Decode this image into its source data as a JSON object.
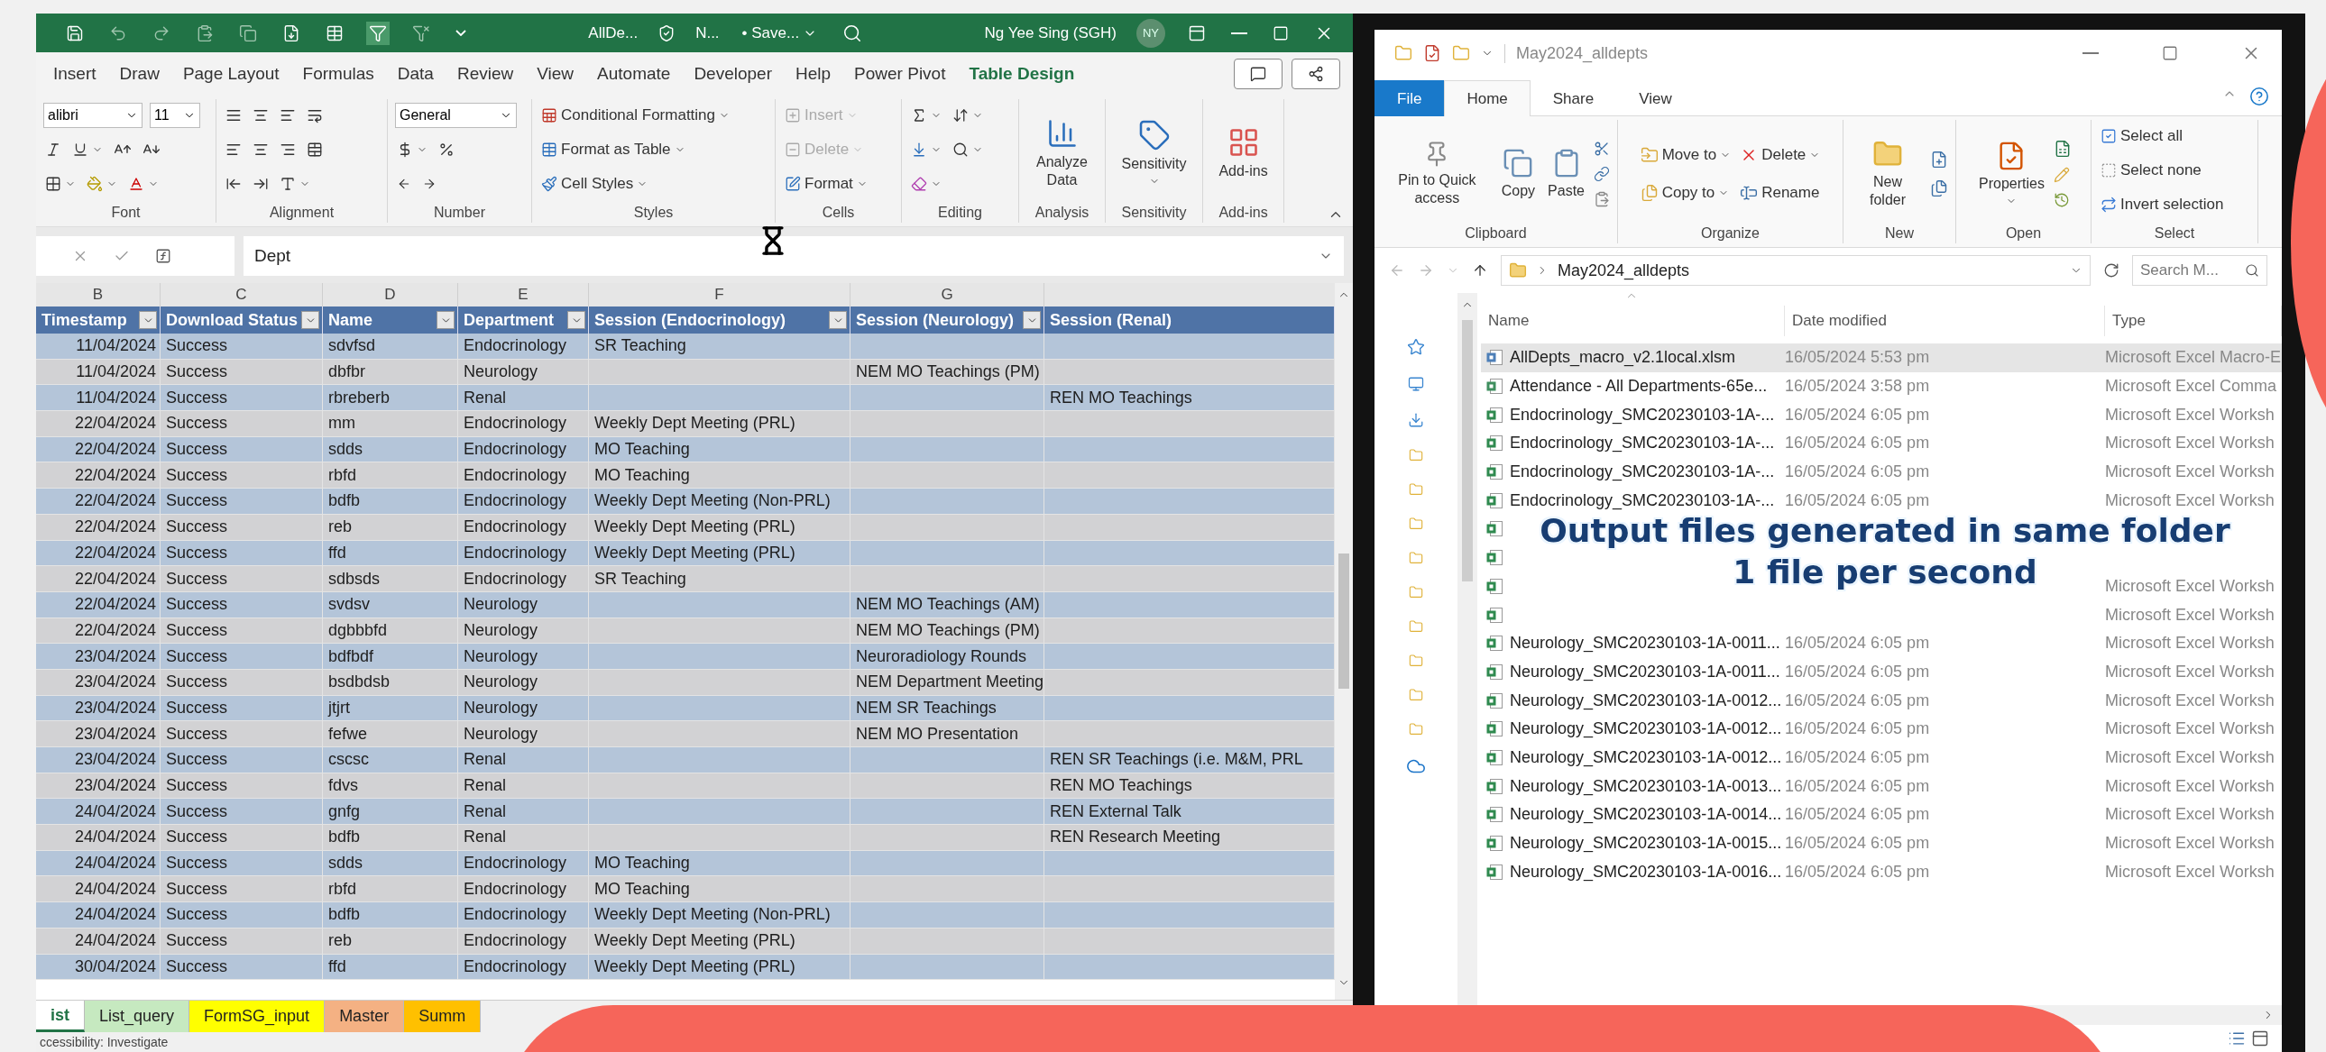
{
  "excel": {
    "title_bar": {
      "file": "AllDe...",
      "label": "N...",
      "save_status": "• Save...",
      "user": "Ng Yee Sing (SGH)",
      "avatar": "NY"
    },
    "tabs": [
      {
        "label": "Insert",
        "kind": "standard"
      },
      {
        "label": "Draw",
        "kind": "standard"
      },
      {
        "label": "Page Layout",
        "kind": "standard"
      },
      {
        "label": "Formulas",
        "kind": "standard"
      },
      {
        "label": "Data",
        "kind": "standard"
      },
      {
        "label": "Review",
        "kind": "standard"
      },
      {
        "label": "View",
        "kind": "standard"
      },
      {
        "label": "Automate",
        "kind": "standard"
      },
      {
        "label": "Developer",
        "kind": "standard"
      },
      {
        "label": "Help",
        "kind": "standard"
      },
      {
        "label": "Power Pivot",
        "kind": "standard"
      },
      {
        "label": "Table Design",
        "kind": "contextual"
      }
    ],
    "font": {
      "name": "alibri",
      "size": "11",
      "group": "Font"
    },
    "alignment": {
      "group": "Alignment"
    },
    "number": {
      "format": "General",
      "group": "Number"
    },
    "styles": {
      "items": [
        "Conditional Formatting",
        "Format as Table",
        "Cell Styles"
      ],
      "group": "Styles"
    },
    "cells": {
      "items": [
        {
          "label": "Insert",
          "disabled": true
        },
        {
          "label": "Delete",
          "disabled": true
        },
        {
          "label": "Format",
          "disabled": false
        }
      ],
      "group": "Cells"
    },
    "editing": {
      "group": "Editing"
    },
    "analysis": {
      "button": "Analyze Data",
      "group": "Analysis"
    },
    "sensitivity": {
      "button": "Sensitivity",
      "group": "Sensitivity"
    },
    "addins": {
      "button": "Add-ins",
      "group": "Add-ins"
    },
    "formula_bar": {
      "value": "Dept"
    },
    "sheet": {
      "column_letters": [
        "B",
        "C",
        "D",
        "E",
        "F",
        "G"
      ],
      "columns": [
        "Timestamp",
        "Download Status",
        "Name",
        "Department",
        "Session (Endocrinology)",
        "Session (Neurology)",
        "Session (Renal)"
      ],
      "rows": [
        {
          "timestamp": "11/04/2024",
          "status": "Success",
          "name": "sdvfsd",
          "department": "Endocrinology",
          "endocrinology": "SR Teaching"
        },
        {
          "timestamp": "11/04/2024",
          "status": "Success",
          "name": "dbfbr",
          "department": "Neurology",
          "neurology": "NEM MO Teachings (PM)"
        },
        {
          "timestamp": "11/04/2024",
          "status": "Success",
          "name": "rbreberb",
          "department": "Renal",
          "renal": "REN MO Teachings"
        },
        {
          "timestamp": "22/04/2024",
          "status": "Success",
          "name": "mm",
          "department": "Endocrinology",
          "endocrinology": "Weekly Dept Meeting (PRL)"
        },
        {
          "timestamp": "22/04/2024",
          "status": "Success",
          "name": "sdds",
          "department": "Endocrinology",
          "endocrinology": "MO Teaching"
        },
        {
          "timestamp": "22/04/2024",
          "status": "Success",
          "name": "rbfd",
          "department": "Endocrinology",
          "endocrinology": "MO Teaching"
        },
        {
          "timestamp": "22/04/2024",
          "status": "Success",
          "name": "bdfb",
          "department": "Endocrinology",
          "endocrinology": "Weekly Dept Meeting (Non-PRL)"
        },
        {
          "timestamp": "22/04/2024",
          "status": "Success",
          "name": "reb",
          "department": "Endocrinology",
          "endocrinology": "Weekly Dept Meeting (PRL)"
        },
        {
          "timestamp": "22/04/2024",
          "status": "Success",
          "name": "ffd",
          "department": "Endocrinology",
          "endocrinology": "Weekly Dept Meeting (PRL)"
        },
        {
          "timestamp": "22/04/2024",
          "status": "Success",
          "name": "sdbsds",
          "department": "Endocrinology",
          "endocrinology": "SR Teaching"
        },
        {
          "timestamp": "22/04/2024",
          "status": "Success",
          "name": "svdsv",
          "department": "Neurology",
          "neurology": "NEM MO Teachings (AM)"
        },
        {
          "timestamp": "22/04/2024",
          "status": "Success",
          "name": "dgbbbfd",
          "department": "Neurology",
          "neurology": "NEM MO Teachings (PM)"
        },
        {
          "timestamp": "23/04/2024",
          "status": "Success",
          "name": "bdfbdf",
          "department": "Neurology",
          "neurology": "Neuroradiology Rounds"
        },
        {
          "timestamp": "23/04/2024",
          "status": "Success",
          "name": "bsdbdsb",
          "department": "Neurology",
          "neurology": "NEM Department Meeting"
        },
        {
          "timestamp": "23/04/2024",
          "status": "Success",
          "name": "jtjrt",
          "department": "Neurology",
          "neurology": "NEM SR Teachings"
        },
        {
          "timestamp": "23/04/2024",
          "status": "Success",
          "name": "fefwe",
          "department": "Neurology",
          "neurology": "NEM MO Presentation"
        },
        {
          "timestamp": "23/04/2024",
          "status": "Success",
          "name": "cscsc",
          "department": "Renal",
          "renal": "REN SR Teachings (i.e. M&M, PRL"
        },
        {
          "timestamp": "23/04/2024",
          "status": "Success",
          "name": "fdvs",
          "department": "Renal",
          "renal": "REN MO Teachings"
        },
        {
          "timestamp": "24/04/2024",
          "status": "Success",
          "name": "gnfg",
          "department": "Renal",
          "renal": "REN External Talk"
        },
        {
          "timestamp": "24/04/2024",
          "status": "Success",
          "name": "bdfb",
          "department": "Renal",
          "renal": "REN Research Meeting"
        },
        {
          "timestamp": "24/04/2024",
          "status": "Success",
          "name": "sdds",
          "department": "Endocrinology",
          "endocrinology": "MO Teaching"
        },
        {
          "timestamp": "24/04/2024",
          "status": "Success",
          "name": "rbfd",
          "department": "Endocrinology",
          "endocrinology": "MO Teaching"
        },
        {
          "timestamp": "24/04/2024",
          "status": "Success",
          "name": "bdfb",
          "department": "Endocrinology",
          "endocrinology": "Weekly Dept Meeting (Non-PRL)"
        },
        {
          "timestamp": "24/04/2024",
          "status": "Success",
          "name": "reb",
          "department": "Endocrinology",
          "endocrinology": "Weekly Dept Meeting (PRL)"
        },
        {
          "timestamp": "30/04/2024",
          "status": "Success",
          "name": "ffd",
          "department": "Endocrinology",
          "endocrinology": "Weekly Dept Meeting (PRL)"
        }
      ]
    },
    "sheet_tabs": [
      {
        "label": "ist",
        "selected": true,
        "color": "#ffffff"
      },
      {
        "label": "List_query",
        "selected": false,
        "color": "#c6e9c0"
      },
      {
        "label": "FormSG_input",
        "selected": false,
        "color": "#ffff00"
      },
      {
        "label": "Master",
        "selected": false,
        "color": "#f4b183"
      },
      {
        "label": "Summ",
        "selected": false,
        "color": "#ffc000"
      }
    ],
    "status_bar": "ccessibility: Investigate"
  },
  "explorer": {
    "title": "May2024_alldepts",
    "tabs": [
      {
        "label": "File",
        "kind": "file",
        "selected": false
      },
      {
        "label": "Home",
        "kind": "standard",
        "selected": true
      },
      {
        "label": "Share",
        "kind": "standard",
        "selected": false
      },
      {
        "label": "View",
        "kind": "standard",
        "selected": false
      }
    ],
    "clipboard": {
      "pin": "Pin to Quick access",
      "copy": "Copy",
      "paste": "Paste",
      "group": "Clipboard"
    },
    "organize": {
      "move": "Move to",
      "copy_to": "Copy to",
      "delete": "Delete",
      "rename": "Rename",
      "group": "Organize"
    },
    "new": {
      "folder": "New folder",
      "group": "New"
    },
    "open": {
      "properties": "Properties",
      "group": "Open"
    },
    "select": {
      "items": [
        "Select all",
        "Select none",
        "Invert selection"
      ],
      "group": "Select"
    },
    "address": "May2024_alldepts",
    "search": {
      "placeholder": "Search M..."
    },
    "columns": [
      "Name",
      "Date modified",
      "Type"
    ],
    "files": [
      {
        "kind": "macro",
        "name": "AllDepts_macro_v2.1local.xlsm",
        "date": "16/05/2024 5:53 pm",
        "type": "Microsoft Excel Macro-E",
        "selected": true
      },
      {
        "kind": "csv",
        "name": "Attendance - All Departments-65e...",
        "date": "16/05/2024 3:58 pm",
        "type": "Microsoft Excel Comma",
        "selected": false
      },
      {
        "kind": "worksheet",
        "name": "Endocrinology_SMC20230103-1A-...",
        "date": "16/05/2024 6:05 pm",
        "type": "Microsoft Excel Worksh",
        "selected": false
      },
      {
        "kind": "worksheet",
        "name": "Endocrinology_SMC20230103-1A-...",
        "date": "16/05/2024 6:05 pm",
        "type": "Microsoft Excel Worksh",
        "selected": false
      },
      {
        "kind": "worksheet",
        "name": "Endocrinology_SMC20230103-1A-...",
        "date": "16/05/2024 6:05 pm",
        "type": "Microsoft Excel Worksh",
        "selected": false
      },
      {
        "kind": "worksheet",
        "name": "Endocrinology_SMC20230103-1A-...",
        "date": "16/05/2024 6:05 pm",
        "type": "Microsoft Excel Worksh",
        "selected": false
      },
      {
        "kind": "worksheet",
        "selected": false
      },
      {
        "kind": "worksheet",
        "selected": false
      },
      {
        "kind": "worksheet",
        "type": "Microsoft Excel Worksh",
        "selected": false
      },
      {
        "kind": "worksheet",
        "type": "Microsoft Excel Worksh",
        "selected": false
      },
      {
        "kind": "worksheet",
        "name": "Neurology_SMC20230103-1A-0011...",
        "date": "16/05/2024 6:05 pm",
        "type": "Microsoft Excel Worksh",
        "selected": false
      },
      {
        "kind": "worksheet",
        "name": "Neurology_SMC20230103-1A-0011...",
        "date": "16/05/2024 6:05 pm",
        "type": "Microsoft Excel Worksh",
        "selected": false
      },
      {
        "kind": "worksheet",
        "name": "Neurology_SMC20230103-1A-0012...",
        "date": "16/05/2024 6:05 pm",
        "type": "Microsoft Excel Worksh",
        "selected": false
      },
      {
        "kind": "worksheet",
        "name": "Neurology_SMC20230103-1A-0012...",
        "date": "16/05/2024 6:05 pm",
        "type": "Microsoft Excel Worksh",
        "selected": false
      },
      {
        "kind": "worksheet",
        "name": "Neurology_SMC20230103-1A-0012...",
        "date": "16/05/2024 6:05 pm",
        "type": "Microsoft Excel Worksh",
        "selected": false
      },
      {
        "kind": "worksheet",
        "name": "Neurology_SMC20230103-1A-0013...",
        "date": "16/05/2024 6:05 pm",
        "type": "Microsoft Excel Worksh",
        "selected": false
      },
      {
        "kind": "worksheet",
        "name": "Neurology_SMC20230103-1A-0014...",
        "date": "16/05/2024 6:05 pm",
        "type": "Microsoft Excel Worksh",
        "selected": false
      },
      {
        "kind": "worksheet",
        "name": "Neurology_SMC20230103-1A-0015...",
        "date": "16/05/2024 6:05 pm",
        "type": "Microsoft Excel Worksh",
        "selected": false
      },
      {
        "kind": "worksheet",
        "name": "Neurology_SMC20230103-1A-0016...",
        "date": "16/05/2024 6:05 pm",
        "type": "Microsoft Excel Worksh",
        "selected": false
      }
    ]
  },
  "caption": [
    "Output files generated in same folder",
    "1 file per second"
  ]
}
